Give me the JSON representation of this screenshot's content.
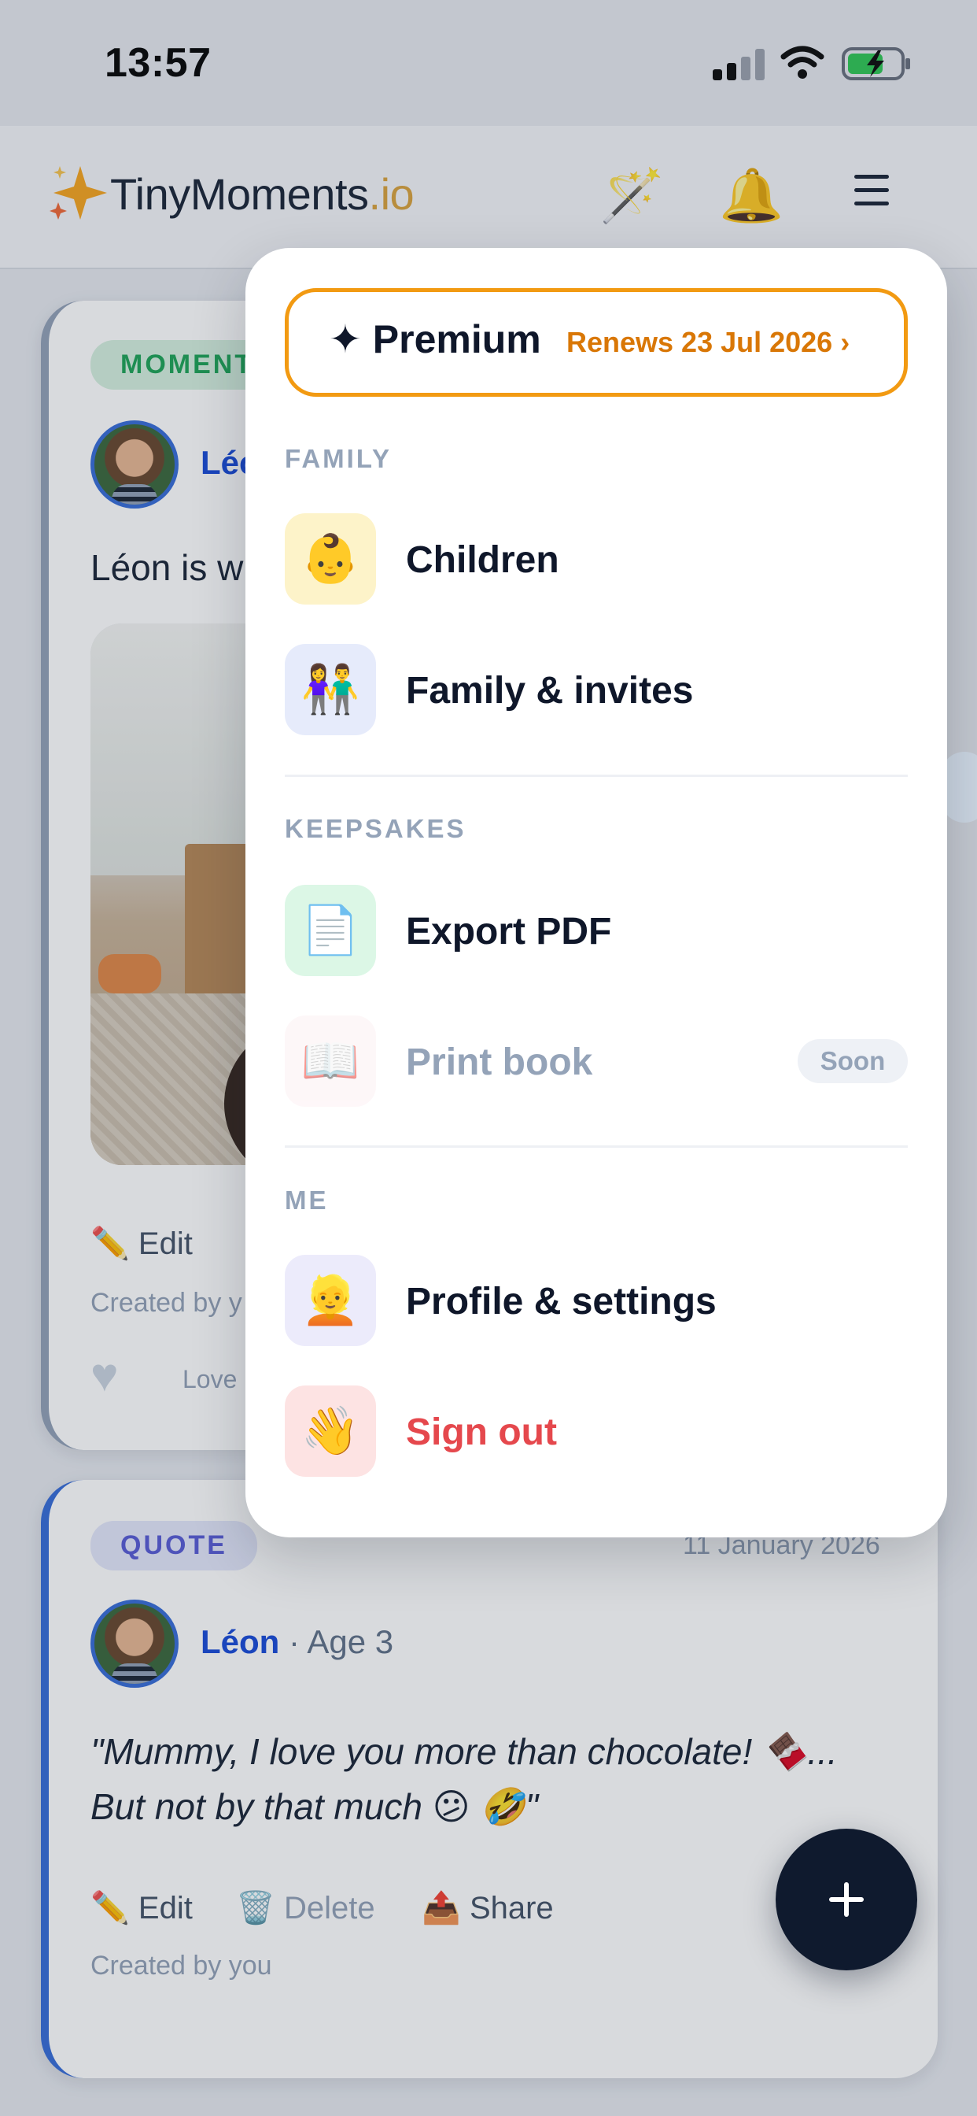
{
  "status_bar": {
    "time": "13:57"
  },
  "header": {
    "logo_main": "TinyMoments",
    "logo_domain": ".io",
    "icons": [
      "magic-wand-icon",
      "bell-icon",
      "hamburger-menu-icon"
    ]
  },
  "feed": {
    "card1": {
      "tag": "MOMENT",
      "author": "Léo",
      "text": "Léon is w",
      "edit": "Edit",
      "created_by": "Created by y",
      "love": "Love"
    },
    "card2": {
      "tag": "QUOTE",
      "date": "11 January 2026",
      "author": "Léon",
      "age": "· Age 3",
      "quote_line1": "\"Mummy, I love you more than chocolate! 🍫...",
      "quote_line2": "But not by that much 😕 🤣\"",
      "edit": "Edit",
      "delete": "Delete",
      "share": "Share",
      "created_by": "Created by you"
    }
  },
  "menu": {
    "premium": {
      "label": "Premium",
      "renewal": "Renews 23 Jul 2026 ›"
    },
    "sections": {
      "family": "FAMILY",
      "keepsakes": "KEEPSAKES",
      "me": "ME"
    },
    "items": {
      "children": {
        "emoji": "👶",
        "label": "Children"
      },
      "family_invites": {
        "emoji": "👫",
        "label": "Family & invites"
      },
      "export_pdf": {
        "emoji": "📄",
        "label": "Export PDF"
      },
      "print_book": {
        "emoji": "📖",
        "label": "Print book",
        "badge": "Soon"
      },
      "profile_settings": {
        "emoji": "👱",
        "label": "Profile & settings"
      },
      "sign_out": {
        "emoji": "👋",
        "label": "Sign out"
      }
    }
  },
  "colors": {
    "accent_orange": "#d97706",
    "premium_border": "#f29a12",
    "danger": "#e5484d",
    "brand_blue": "#3b6fd8",
    "fab": "#0f1a2e"
  }
}
